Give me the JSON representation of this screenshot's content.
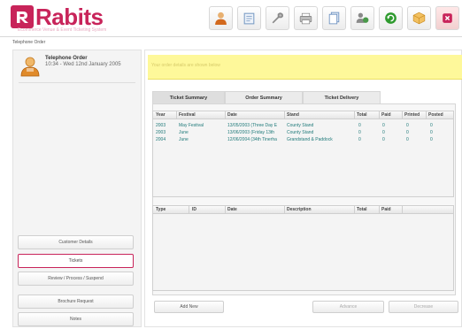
{
  "app": {
    "name": "Rabits",
    "tagline": "Ecommerce Venue & Event Ticketing System"
  },
  "toolbar": {
    "icons": [
      {
        "name": "customer-icon",
        "color": "#d2691e"
      },
      {
        "name": "document-icon",
        "color": "#7a9bc4"
      },
      {
        "name": "tools-icon",
        "color": "#8a8a8a"
      },
      {
        "name": "print-icon",
        "color": "#7a7a7a"
      },
      {
        "name": "pages-icon",
        "color": "#6a8fbf"
      },
      {
        "name": "users-icon",
        "color": "#4a9a4a"
      },
      {
        "name": "refresh-icon",
        "color": "#2e9a2e"
      },
      {
        "name": "box-icon",
        "color": "#e0a030"
      },
      {
        "name": "exit-icon",
        "color": "#c8245a"
      }
    ]
  },
  "breadcrumb": "Telephone Order",
  "order": {
    "title": "Telephone Order",
    "datetime": "10:34 - Wed 12nd January 2005"
  },
  "notice": "Your order details are shown below",
  "tabs": [
    {
      "label": "Ticket Summary",
      "active": true
    },
    {
      "label": "Order Summary",
      "active": false
    },
    {
      "label": "Ticket Delivery",
      "active": false
    }
  ],
  "ticket_grid": {
    "columns": [
      "Year",
      "Festival",
      "Date",
      "Stand",
      "Total",
      "Paid",
      "Printed",
      "Posted"
    ],
    "rows": [
      [
        "2003",
        "May Festival",
        "13/05/2003 (Three Day E",
        "County Stand",
        "0",
        "0",
        "0",
        "0"
      ],
      [
        "2003",
        "June",
        "13/06/2003 (Friday 13th",
        "County Stand",
        "0",
        "0",
        "0",
        "0"
      ],
      [
        "2004",
        "June",
        "12/06/2004 (34th Tinerha",
        "Grandstand & Paddock",
        "0",
        "0",
        "0",
        "0"
      ]
    ]
  },
  "detail_grid": {
    "columns": [
      "Type",
      "ID",
      "Date",
      "Description",
      "Total",
      "Paid"
    ]
  },
  "side_buttons": [
    {
      "label": "Customer Details",
      "active": false
    },
    {
      "label": "Tickets",
      "active": true
    },
    {
      "label": "Review / Process / Suspend",
      "active": false
    },
    {
      "label": "Brochure Request",
      "active": false
    },
    {
      "label": "Notes",
      "active": false
    }
  ],
  "bottom_buttons": {
    "add_new": "Add New",
    "advance": "Advance",
    "decrease": "Decrease"
  },
  "colors": {
    "brand": "#c8245a",
    "notice_bg": "#fef89a",
    "grid_text": "#1f7a7a"
  }
}
